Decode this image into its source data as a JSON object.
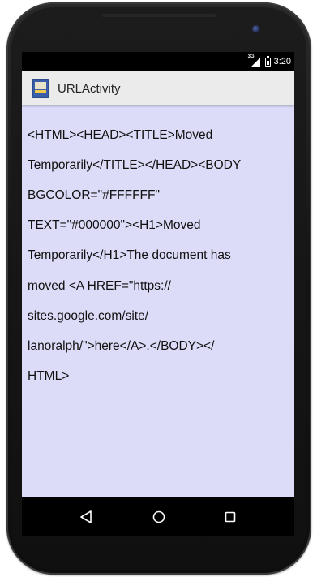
{
  "status_bar": {
    "network": "3G",
    "time": "3:20"
  },
  "action_bar": {
    "title": "URLActivity",
    "icon": "app-icon"
  },
  "content": {
    "lines": [
      "<HTML><HEAD><TITLE>Moved",
      "Temporarily</TITLE></HEAD><BODY",
      "BGCOLOR=\"#FFFFFF\"",
      "TEXT=\"#000000\"><H1>Moved",
      "Temporarily</H1>The document has",
      "moved <A HREF=\"https://",
      "sites.google.com/site/",
      "lanoralph/\">here</A>.</BODY></",
      "HTML>"
    ]
  },
  "nav_bar": {
    "back_icon": "back-triangle-icon",
    "home_icon": "home-circle-icon",
    "recents_icon": "recents-square-icon"
  },
  "colors": {
    "screen_background": "#dcdcf8",
    "action_bar": "#ebebeb",
    "status_bar": "#000000"
  }
}
